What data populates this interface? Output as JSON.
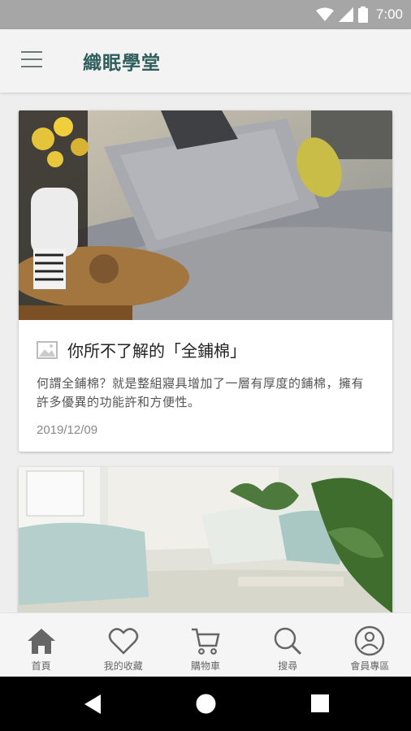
{
  "status": {
    "time": "7:00"
  },
  "app": {
    "title": "織眠學堂"
  },
  "articles": [
    {
      "title": "你所不了解的「全鋪棉」",
      "summary": "何謂全鋪棉？就是整組寢具增加了一層有厚度的鋪棉，擁有許多優異的功能許和方便性。",
      "date": "2019/12/09"
    }
  ],
  "bottom_nav": [
    {
      "label": "首頁",
      "icon": "home-icon"
    },
    {
      "label": "我的收藏",
      "icon": "heart-icon"
    },
    {
      "label": "購物車",
      "icon": "cart-icon"
    },
    {
      "label": "搜尋",
      "icon": "search-icon"
    },
    {
      "label": "會員專區",
      "icon": "user-icon"
    }
  ],
  "colors": {
    "accent": "#2f5f5c",
    "nav_icon": "#666666",
    "status_bar": "#a6a6a6"
  }
}
